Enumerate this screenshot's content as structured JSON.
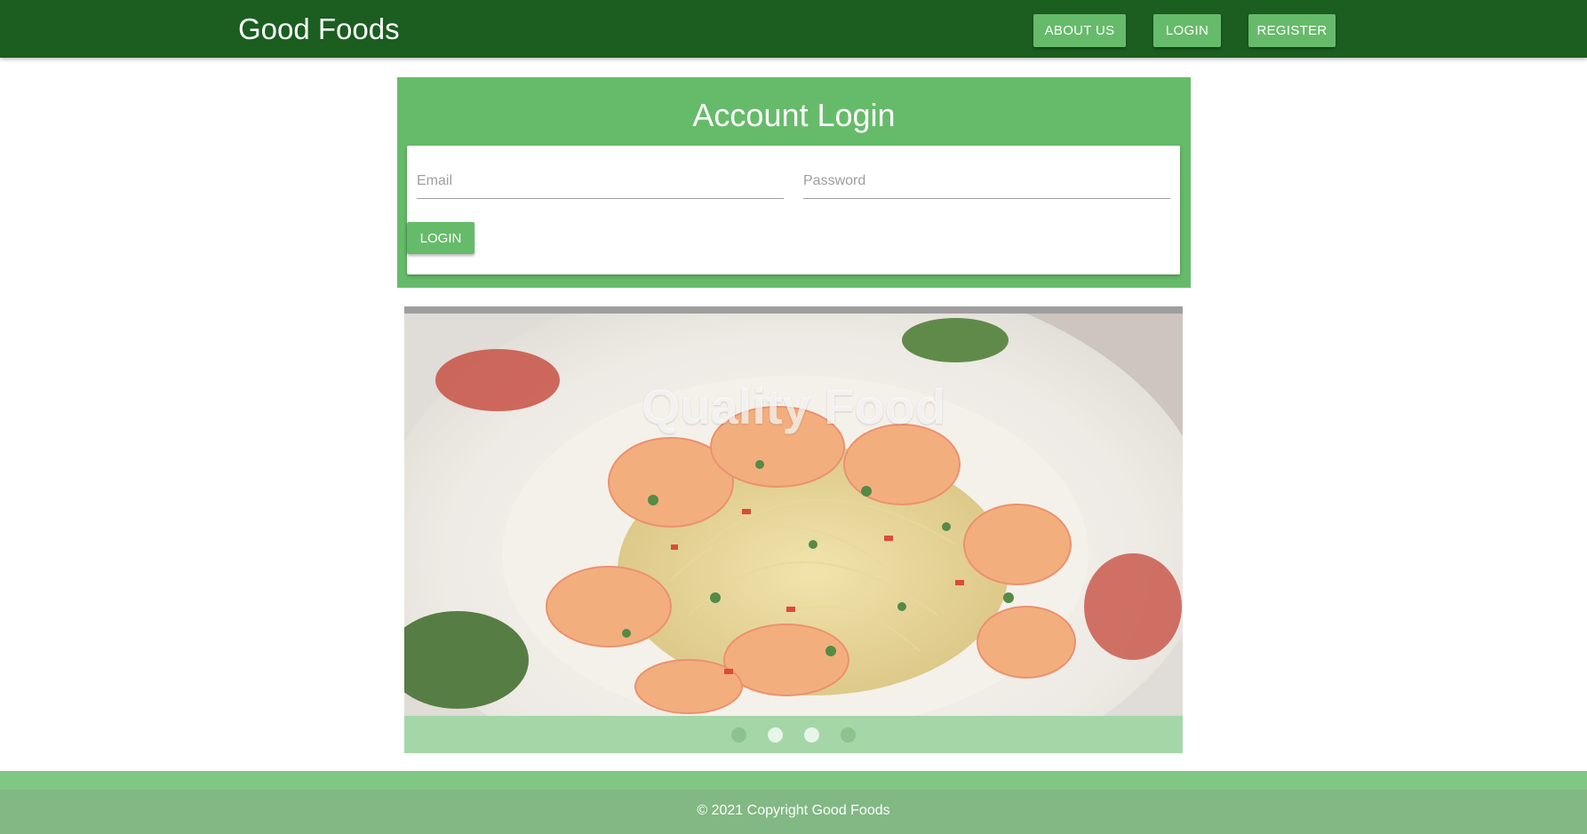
{
  "header": {
    "brand": "Good Foods",
    "nav": {
      "about": "ABOUT US",
      "login": "LOGIN",
      "register": "REGISTER"
    }
  },
  "login": {
    "title": "Account Login",
    "email_placeholder": "Email",
    "password_placeholder": "Password",
    "submit_label": "LOGIN"
  },
  "carousel": {
    "caption": "Quality Food",
    "slide_count": 4,
    "active_index": 1
  },
  "footer": {
    "copyright": "© 2021 Copyright Good Foods"
  },
  "colors": {
    "navbar": "#1b5e20",
    "accent": "#66bb6a",
    "carousel_bg": "#a5d6a7",
    "footer": "#81b883"
  }
}
